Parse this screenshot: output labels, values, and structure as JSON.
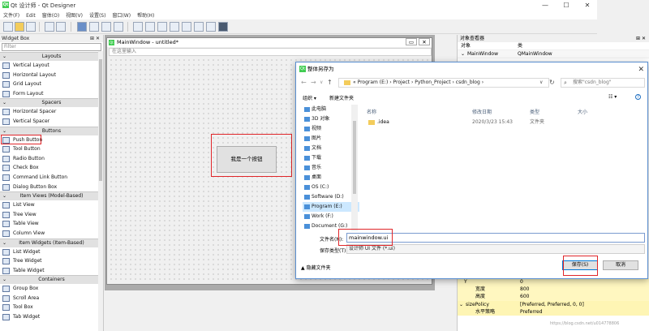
{
  "app": {
    "title": "Qt 设计师 - Qt Designer",
    "logo": "Qt"
  },
  "window_controls": {
    "minimize": "—",
    "maximize": "☐",
    "close": "✕"
  },
  "menubar": {
    "items": [
      "文件(F)",
      "Edit",
      "窗体(O)",
      "视图(V)",
      "设置(S)",
      "窗口(W)",
      "帮助(H)"
    ]
  },
  "widget_box": {
    "title": "Widget Box",
    "pin": "⊞ ✕",
    "filter_placeholder": "Filter",
    "categories": [
      {
        "label": "Layouts",
        "items": [
          "Vertical Layout",
          "Horizontal Layout",
          "Grid Layout",
          "Form Layout"
        ]
      },
      {
        "label": "Spacers",
        "items": [
          "Horizontal Spacer",
          "Vertical Spacer"
        ]
      },
      {
        "label": "Buttons",
        "items": [
          "Push Button",
          "Tool Button",
          "Radio Button",
          "Check Box",
          "Command Link Button",
          "Dialog Button Box"
        ]
      },
      {
        "label": "Item Views (Model-Based)",
        "items": [
          "List View",
          "Tree View",
          "Table View",
          "Column View"
        ]
      },
      {
        "label": "Item Widgets (Item-Based)",
        "items": [
          "List Widget",
          "Tree Widget",
          "Table Widget"
        ]
      },
      {
        "label": "Containers",
        "items": [
          "Group Box",
          "Scroll Area",
          "Tool Box",
          "Tab Widget"
        ]
      }
    ]
  },
  "main_window": {
    "title": "MainWindow - untitled*",
    "type_here": "在这里输入",
    "button_label": "我是一个按钮",
    "win_ctrls": [
      "▭",
      "✕"
    ]
  },
  "object_inspector": {
    "title": "对象查看器",
    "pin": "⊞ ✕",
    "headers": [
      "对象",
      "类"
    ],
    "rows": [
      {
        "object": "MainWindow",
        "class": "QMainWindow"
      }
    ]
  },
  "property_editor": {
    "rows": [
      {
        "name": "Y",
        "value": "0"
      },
      {
        "name": "宽度",
        "value": "800"
      },
      {
        "name": "高度",
        "value": "600"
      },
      {
        "name": "sizePolicy",
        "value": "[Preferred, Preferred, 0, 0]"
      },
      {
        "name": "水平策略",
        "value": "Preferred"
      }
    ]
  },
  "save_dialog": {
    "title": "整体另存为",
    "close": "✕",
    "nav": {
      "back": "←",
      "forward": "→",
      "dropdown": "∨",
      "up": "↑",
      "refresh": "↻"
    },
    "breadcrumb": "« Program (E:) › Project › Python_Project › csdn_blog ›",
    "search_placeholder": "搜索\"csdn_blog\"",
    "search_icon": "⌕",
    "toolbar": {
      "organize": "组织 ▾",
      "new_folder": "新建文件夹",
      "view": "☷ ▾",
      "help": "?"
    },
    "sidebar": [
      {
        "label": "此电脑",
        "selected": false
      },
      {
        "label": "3D 对象",
        "selected": false
      },
      {
        "label": "视频",
        "selected": false
      },
      {
        "label": "图片",
        "selected": false
      },
      {
        "label": "文档",
        "selected": false
      },
      {
        "label": "下载",
        "selected": false
      },
      {
        "label": "音乐",
        "selected": false
      },
      {
        "label": "桌面",
        "selected": false
      },
      {
        "label": "OS (C:)",
        "selected": false
      },
      {
        "label": "Software (D:)",
        "selected": false
      },
      {
        "label": "Program (E:)",
        "selected": true
      },
      {
        "label": "Work (F:)",
        "selected": false
      },
      {
        "label": "Document (G:)",
        "selected": false
      }
    ],
    "columns": [
      "名称",
      "修改日期",
      "类型",
      "大小"
    ],
    "files": [
      {
        "name": ".idea",
        "modified": "2020/3/23 15:43",
        "type": "文件夹",
        "size": ""
      }
    ],
    "filename_label": "文件名(N):",
    "filename_value": "mainwindow.ui",
    "filetype_label": "保存类型(T):",
    "filetype_value": "设计师 UI 文件 (*.ui)",
    "hide_folders": "▲ 隐藏文件夹",
    "save_button": "保存(S)",
    "cancel_button": "取消"
  },
  "watermark": "https://blog.csdn.net/u014778806",
  "colors": {
    "highlight_red": "#e0262a",
    "selection_blue": "#cce8ff",
    "accent_blue": "#0078d7"
  }
}
